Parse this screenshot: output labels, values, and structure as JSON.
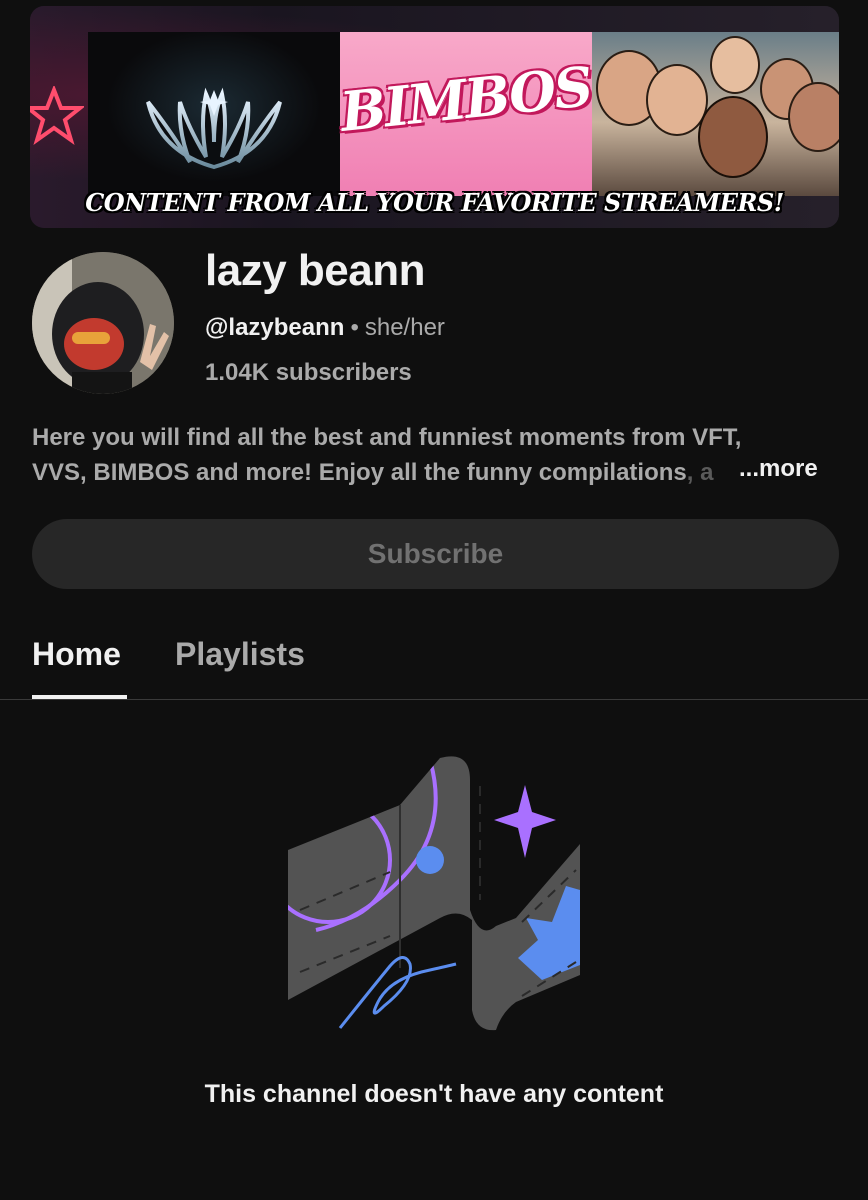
{
  "banner": {
    "caption": "CONTENT FROM ALL YOUR FAVORITE STREAMERS!",
    "center_logo_text": "BIMBOS"
  },
  "channel": {
    "name": "lazy beann",
    "handle": "@lazybeann",
    "separator": "•",
    "pronouns": "she/her",
    "subscribers": "1.04K subscribers"
  },
  "description": {
    "line1": "Here you will find all the best and funniest moments from VFT,",
    "line2": "VVS, BIMBOS and more! Enjoy all the funny compilations",
    "line2_cut": ", a",
    "more_label": "...more"
  },
  "subscribe": {
    "label": "Subscribe"
  },
  "tabs": [
    {
      "label": "Home",
      "selected": true
    },
    {
      "label": "Playlists",
      "selected": false
    }
  ],
  "empty_state": {
    "message": "This channel doesn't have any content",
    "icon": "empty-channel-illustration"
  },
  "colors": {
    "background": "#0f0f0f",
    "primary_text": "#f1f1f1",
    "secondary_text": "#aaaaaa",
    "button_bg": "#272727",
    "accent_purple": "#a970ff",
    "accent_blue": "#5b8def"
  }
}
